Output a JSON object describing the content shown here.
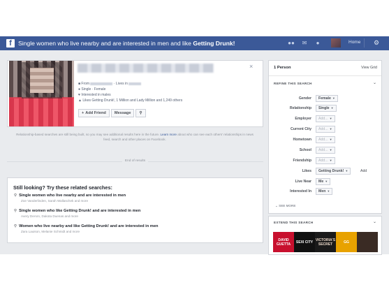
{
  "topbar": {
    "logo": "f",
    "query_prefix": "Single women who live nearby and are interested in men and like ",
    "query_highlight": "Getting Drunk!",
    "home_label": "Home",
    "icons": [
      "friends-icon",
      "messages-icon",
      "globe-icon",
      "gear-icon"
    ]
  },
  "result": {
    "close": "×",
    "details": [
      {
        "icon": "briefcase-icon",
        "text": "From",
        "text2": "· Lives in"
      },
      {
        "icon": "person-icon",
        "text": "Single · Female"
      },
      {
        "icon": "heart-icon",
        "text": "Interested in males"
      },
      {
        "icon": "like-icon",
        "text": "Likes Getting Drunk!, 1 Million and Lady Million and 1,249 others"
      }
    ],
    "buttons": {
      "add_friend": "Add Friend",
      "message": "Message",
      "more_icon": "search-icon"
    }
  },
  "notice": {
    "text": "Relationship-based searches are still being built, so you may see additional results here in the future.",
    "link": "Learn more",
    "text2": "about who can see each others' relationships in news feed, search and other places on Facebook."
  },
  "end_of_results": "End of results",
  "related": {
    "title": "Still looking? Try these related searches:",
    "items": [
      {
        "main": "Single women who live nearby and are interested in men",
        "sub": "Zoe Vanderlinden, Sarah Wallaschek and more"
      },
      {
        "main": "Single women who like Getting Drunk! and are interested in men",
        "sub": "Avery DeAnn, Dakota Duenas and more"
      },
      {
        "main": "Women who live nearby and like Getting Drunk! and are interested in men",
        "sub": "Zara Lauison, Melanie Schmidt and more"
      }
    ]
  },
  "sidebar": {
    "count": "1 Person",
    "view_grid": "View Grid",
    "refine_title": "REFINE THIS SEARCH",
    "filters": [
      {
        "label": "Gender",
        "value": "Female",
        "empty": false
      },
      {
        "label": "Relationship",
        "value": "Single",
        "empty": false
      },
      {
        "label": "Employer",
        "value": "Add...",
        "empty": true
      },
      {
        "label": "Current City",
        "value": "Add...",
        "empty": true
      },
      {
        "label": "Hometown",
        "value": "Add...",
        "empty": true
      },
      {
        "label": "School",
        "value": "Add...",
        "empty": true
      },
      {
        "label": "Friendship",
        "value": "Add...",
        "empty": true
      },
      {
        "label": "Likes",
        "value": "Getting Drunk!",
        "empty": false,
        "add": "Add"
      },
      {
        "label": "Live Near",
        "value": "Me",
        "empty": false
      },
      {
        "label": "Interested In",
        "value": "Men",
        "empty": false
      }
    ],
    "see_more": "SEE MORE",
    "extend_title": "EXTEND THIS SEARCH",
    "thumbs": [
      {
        "text": "DAVID GUETTA",
        "bg": "#c8102e",
        "fg": "#ffffff"
      },
      {
        "text": "SEXI CITY",
        "bg": "#111111",
        "fg": "#ffffff"
      },
      {
        "text": "VICTORIA'S SECRET",
        "bg": "#1a1a1a",
        "fg": "#e9d7c7"
      },
      {
        "text": "GG",
        "bg": "#e8a200",
        "fg": "#ffffff"
      },
      {
        "text": "",
        "bg": "#3a2b24",
        "fg": "#ffffff"
      }
    ]
  },
  "colors": {
    "brand": "#3b5998",
    "background": "#e9ebee"
  }
}
